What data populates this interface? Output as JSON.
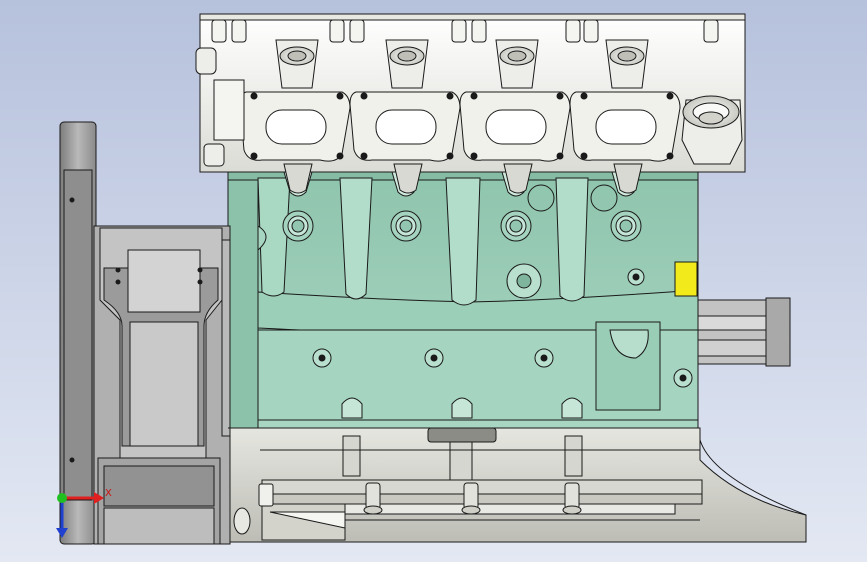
{
  "viewport": {
    "background_top": "#b6c1dc",
    "background_bottom": "#e3e8f3"
  },
  "model": {
    "block_color": "#9fd0bb",
    "head_color": "#f2f2ee",
    "flywheel_color": "#a8a8a8",
    "highlight_face_color": "#f2ea1a",
    "edge_color": "#1a1a1a"
  },
  "triad": {
    "x_color": "#e02020",
    "y_color": "#20c020",
    "z_color": "#2040d0",
    "x_label": "X"
  }
}
